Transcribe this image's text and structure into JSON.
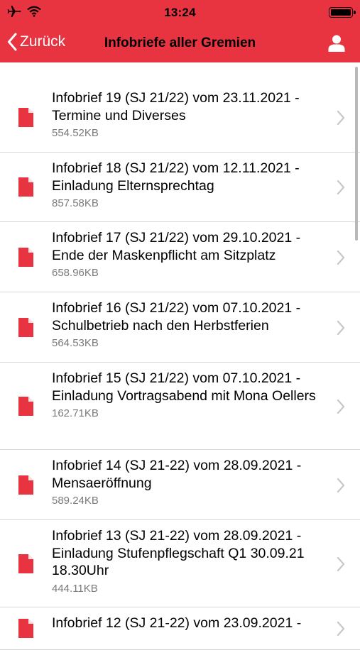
{
  "status_bar": {
    "time": "13:24"
  },
  "nav": {
    "back_label": "Zurück",
    "title": "Infobriefe aller Gremien"
  },
  "colors": {
    "accent": "#e83340",
    "doc_icon": "#e83340",
    "chevron": "#c7c7cc",
    "size_text": "#7a7a7a"
  },
  "items": [
    {
      "title": "Infobrief 19 (SJ 21/22) vom 23.11.2021 - Termine und Diverses",
      "size": "554.52KB"
    },
    {
      "title": "Infobrief 18 (SJ 21/22) vom 12.11.2021 - Einladung Elternsprechtag",
      "size": "857.58KB"
    },
    {
      "title": "Infobrief 17 (SJ 21/22) vom 29.10.2021 - Ende der Maskenpflicht am Sitzplatz",
      "size": "658.96KB"
    },
    {
      "title": "Infobrief 16 (SJ 21/22) vom 07.10.2021 - Schulbetrieb nach den Herbstferien",
      "size": "564.53KB"
    },
    {
      "title": "Infobrief 15 (SJ 21/22) vom 07.10.2021 - Einladung Vortragsabend mit Mona Oellers",
      "size": "162.71KB"
    },
    {
      "title": "Infobrief 14 (SJ 21-22) vom 28.09.2021 - Mensaeröffnung",
      "size": "589.24KB"
    },
    {
      "title": "Infobrief 13 (SJ 21-22) vom 28.09.2021 - Einladung Stufenpflegschaft Q1 30.09.21 18.30Uhr",
      "size": "444.11KB"
    },
    {
      "title": "Infobrief 12 (SJ 21-22) vom 23.09.2021 -",
      "size": ""
    }
  ]
}
